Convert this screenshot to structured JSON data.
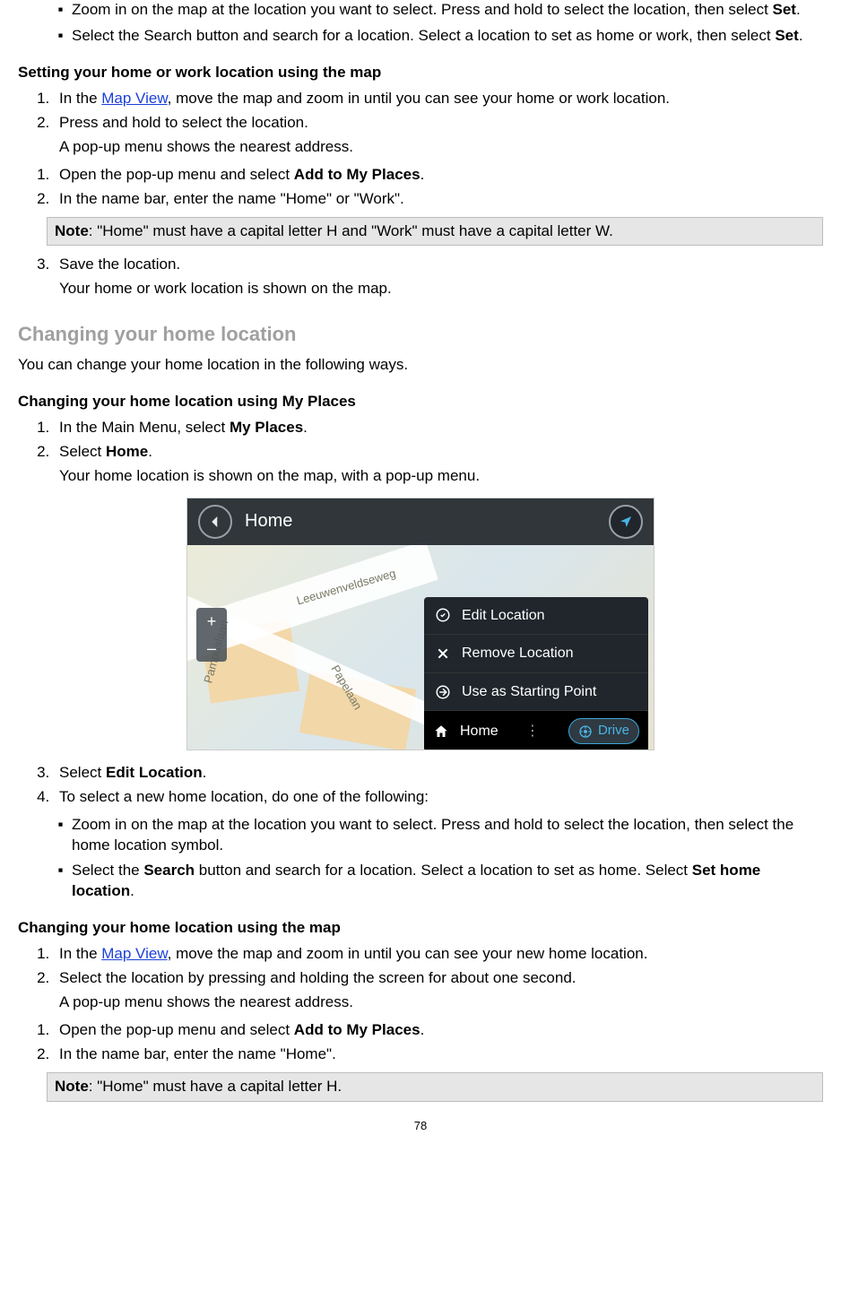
{
  "top_bullets": [
    {
      "pre": "Zoom in on the map at the location you want to select. Press and hold to select the loca­tion, then select ",
      "bold1": "Set",
      "post1": "."
    },
    {
      "pre": "Select the Search button and search for a location. Select a location to set as home or work, then select ",
      "bold1": "Set",
      "post1": "."
    }
  ],
  "sec1": {
    "heading": "Setting your home or work location using the map",
    "step1_pre": "In the ",
    "step1_link": "Map View",
    "step1_post": ", move the map and zoom in until you can see your home or work location.",
    "step2": "Press and hold to select the location.",
    "step2_sub": "A pop-up menu shows the nearest address.",
    "step3_pre": "Open the pop-up menu and select ",
    "step3_bold": "Add to My Places",
    "step3_post": ".",
    "step4": "In the name bar, enter the name \"Home\" or \"Work\".",
    "note_label": "Note",
    "note_text": ": \"Home\" must have a capital letter H and \"Work\" must have a capital letter W.",
    "step5": "Save the location.",
    "step5_sub": "Your home or work location is shown on the map."
  },
  "sec2": {
    "title": "Changing your home location",
    "intro": "You can change your home location in the following ways.",
    "sub1_heading": "Changing your home location using My Places",
    "s1_pre": "In the Main Menu, select ",
    "s1_bold": "My Places",
    "s1_post": ".",
    "s2_pre": "Select ",
    "s2_bold": "Home",
    "s2_post": ".",
    "s2_sub": "Your home location is shown on the map, with a pop-up menu."
  },
  "screenshot": {
    "title": "Home",
    "zoom_in": "+",
    "zoom_out": "–",
    "street1": "Leeuwenveldseweg",
    "street2": "Papelaan",
    "street3": "Pampuslaan",
    "menu": {
      "edit": "Edit Location",
      "remove": "Remove Location",
      "start": "Use as Starting Point",
      "home": "Home",
      "drive": "Drive"
    }
  },
  "sec3": {
    "s3_pre": "Select ",
    "s3_bold": "Edit Location",
    "s3_post": ".",
    "s4": "To select a new home location, do one of the following:",
    "b1": "Zoom in on the map at the location you want to select. Press and hold to select the loca­tion, then select the home location symbol.",
    "b2_pre": "Select the ",
    "b2_bold1": "Search",
    "b2_mid": " button and search for a location. Select a location to set as home. Select ",
    "b2_bold2": "Set home location",
    "b2_post": "."
  },
  "sec4": {
    "heading": "Changing your home location using the map",
    "s1_pre": "In the ",
    "s1_link": "Map View",
    "s1_post": ", move the map and zoom in until you can see your new home location.",
    "s2": "Select the location by pressing and holding the screen for about one second.",
    "s2_sub": "A pop-up menu shows the nearest address.",
    "s3_pre": "Open the pop-up menu and select ",
    "s3_bold": "Add to My Places",
    "s3_post": ".",
    "s4": "In the name bar, enter the name \"Home\".",
    "note_label": "Note",
    "note_text": ": \"Home\" must have a capital letter H."
  },
  "page_number": "78"
}
